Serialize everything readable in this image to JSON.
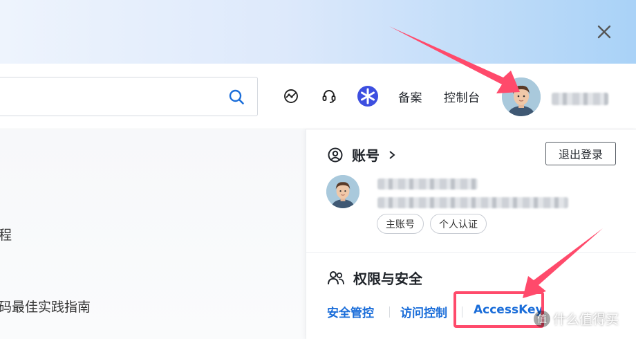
{
  "header": {
    "nav": {
      "beian": "备案",
      "console": "控制台"
    }
  },
  "left_content": {
    "line1": "程",
    "line2": "码最佳实践指南"
  },
  "account_panel": {
    "account_title": "账号",
    "logout_label": "退出登录",
    "tags": [
      "主账号",
      "个人认证"
    ],
    "security_title": "权限与安全",
    "links": [
      "安全管控",
      "访问控制",
      "AccessKey"
    ]
  },
  "watermark": {
    "text": "什么值得买",
    "badge": "值"
  },
  "colors": {
    "link_blue": "#1a6dd9",
    "annotation_red": "#ff4a6b",
    "search_blue": "#1a6dd9"
  }
}
